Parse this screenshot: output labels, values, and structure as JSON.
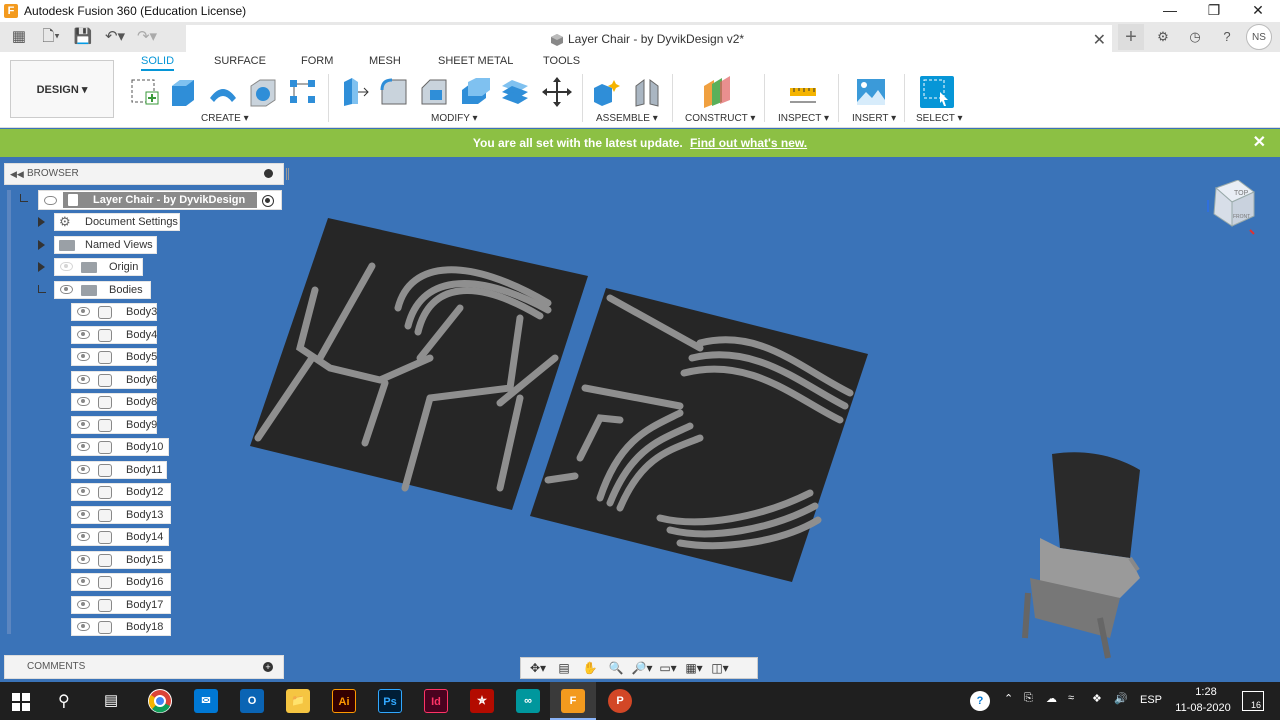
{
  "window": {
    "title": "Autodesk Fusion 360 (Education License)",
    "app_letter": "F"
  },
  "doc_tab": {
    "title": "Layer Chair - by DyvikDesign v2*"
  },
  "user": {
    "initials": "NS"
  },
  "workspace": {
    "label": "DESIGN"
  },
  "ribbon": {
    "tabs": [
      "SOLID",
      "SURFACE",
      "FORM",
      "MESH",
      "SHEET METAL",
      "TOOLS"
    ],
    "active_tab": "SOLID",
    "groups": [
      "CREATE",
      "MODIFY",
      "ASSEMBLE",
      "CONSTRUCT",
      "INSPECT",
      "INSERT",
      "SELECT"
    ]
  },
  "notice": {
    "text": "You are all set with the latest update.",
    "link": "Find out what's new."
  },
  "browser": {
    "title": "BROWSER",
    "root": "Layer Chair - by DyvikDesign ...",
    "nodes": [
      "Document Settings",
      "Named Views",
      "Origin",
      "Bodies"
    ],
    "bodies": [
      "Body3",
      "Body4",
      "Body5",
      "Body6",
      "Body8",
      "Body9",
      "Body10",
      "Body11",
      "Body12",
      "Body13",
      "Body14",
      "Body15",
      "Body16",
      "Body17",
      "Body18"
    ]
  },
  "comments": {
    "title": "COMMENTS"
  },
  "viewcube": {
    "top": "TOP",
    "front": "FRONT"
  },
  "taskbar": {
    "apps": [
      "Chrome",
      "Mail",
      "Outlook",
      "File Explorer",
      "Illustrator",
      "Photoshop",
      "InDesign",
      "Acrobat",
      "Arduino",
      "Fusion 360",
      "PowerPoint"
    ],
    "language": "ESP",
    "time": "1:28",
    "date": "11-08-2020",
    "notification_count": "16"
  },
  "colors": {
    "viewport": "#3a73b8",
    "accent": "#0696d7",
    "notice": "#8cc044"
  }
}
